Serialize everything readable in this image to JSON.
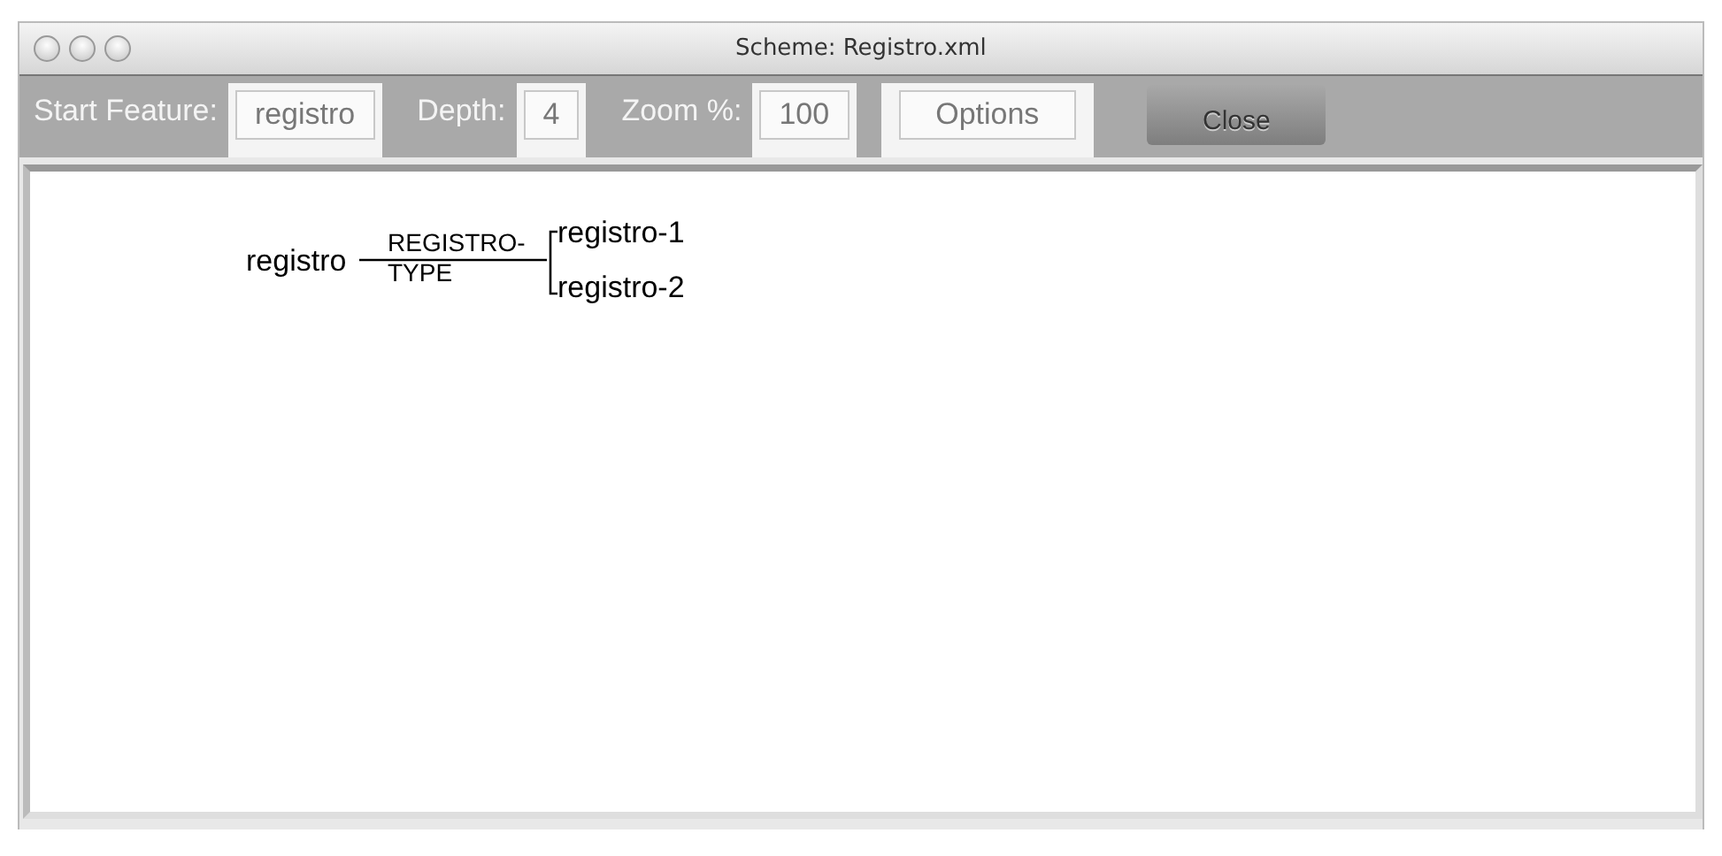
{
  "window": {
    "title": "Scheme: Registro.xml"
  },
  "toolbar": [
    {
      "kind": "field",
      "label": "Start Feature:",
      "value": "registro"
    },
    {
      "kind": "field",
      "label": "Depth:",
      "value": "4"
    },
    {
      "kind": "field",
      "label": "Zoom %:",
      "value": "100"
    },
    {
      "kind": "flat-button",
      "label": "Options"
    },
    {
      "kind": "push-button",
      "label": "Close"
    }
  ],
  "scheme": {
    "root": "registro",
    "edge_label_lines": [
      "REGISTRO-",
      "TYPE"
    ],
    "children": [
      {
        "label": "registro-1"
      },
      {
        "label": "registro-2"
      }
    ]
  }
}
